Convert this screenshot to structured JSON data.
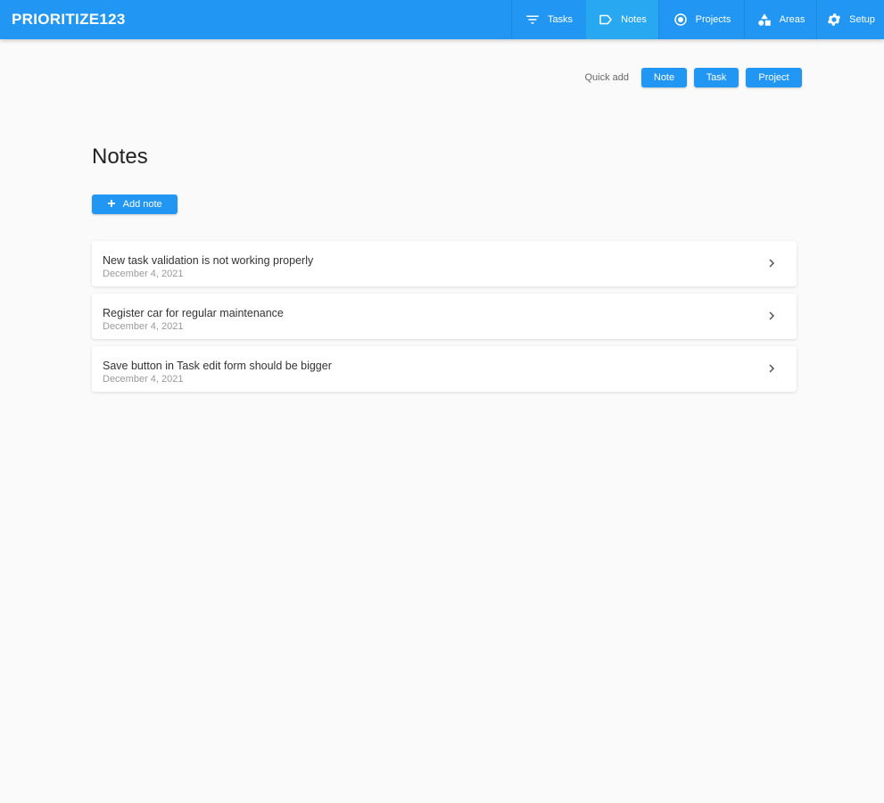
{
  "app": {
    "brand": "PRIORITIZE123"
  },
  "nav": {
    "items": [
      {
        "label": "Tasks",
        "icon": "filter-icon",
        "active": false
      },
      {
        "label": "Notes",
        "icon": "label-icon",
        "active": true
      },
      {
        "label": "Projects",
        "icon": "target-icon",
        "active": false
      },
      {
        "label": "Areas",
        "icon": "shapes-icon",
        "active": false
      },
      {
        "label": "Setup",
        "icon": "gear-icon",
        "active": false
      }
    ]
  },
  "quick_add": {
    "label": "Quick add",
    "note": "Note",
    "task": "Task",
    "project": "Project"
  },
  "page": {
    "title": "Notes",
    "add_button": "Add note"
  },
  "notes": [
    {
      "title": "New task validation is not working properly",
      "date": "December 4, 2021"
    },
    {
      "title": "Register car for regular maintenance",
      "date": "December 4, 2021"
    },
    {
      "title": "Save button in Task edit form should be bigger",
      "date": "December 4, 2021"
    }
  ],
  "colors": {
    "primary": "#2196f3",
    "active_tab": "#29a8f2",
    "background": "#fafafa"
  }
}
